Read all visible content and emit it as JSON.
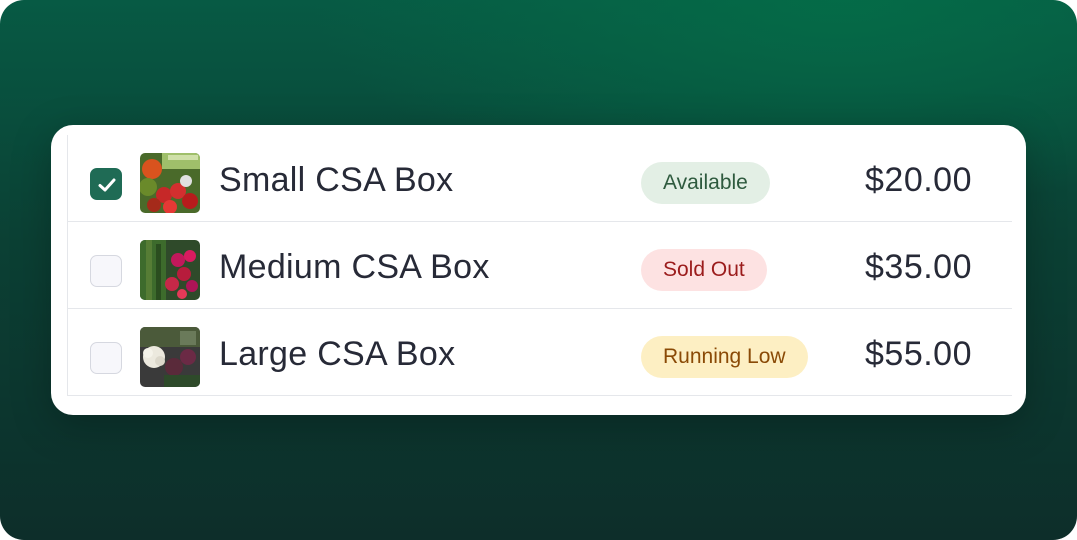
{
  "products": [
    {
      "checked": true,
      "name": "Small CSA Box",
      "status": "Available",
      "status_type": "available",
      "price": "$20.00",
      "image": "vegetables-tomatoes-thumbnail"
    },
    {
      "checked": false,
      "name": "Medium CSA Box",
      "status": "Sold Out",
      "status_type": "soldout",
      "price": "$35.00",
      "image": "radishes-greens-thumbnail"
    },
    {
      "checked": false,
      "name": "Large CSA Box",
      "status": "Running Low",
      "status_type": "low",
      "price": "$55.00",
      "image": "cauliflower-beets-thumbnail"
    }
  ],
  "colors": {
    "accent": "#1f6b55",
    "available_bg": "#e3efe5",
    "soldout_bg": "#fde2e2",
    "low_bg": "#fdefc3"
  }
}
